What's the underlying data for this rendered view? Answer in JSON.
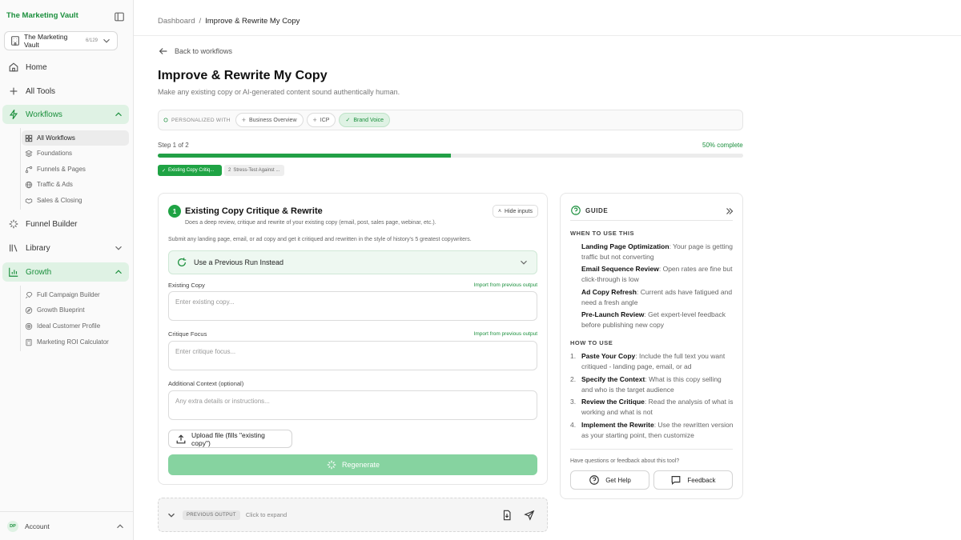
{
  "sidebar": {
    "brand": "The Marketing Vault",
    "workspace": {
      "name": "The Marketing Vault",
      "count": "6/129"
    },
    "nav": {
      "home": "Home",
      "all_tools": "All Tools",
      "workflows": "Workflows",
      "funnel_builder": "Funnel Builder",
      "library": "Library",
      "growth": "Growth"
    },
    "workflow_items": [
      "All Workflows",
      "Foundations",
      "Funnels & Pages",
      "Traffic & Ads",
      "Sales & Closing"
    ],
    "growth_items": [
      "Full Campaign Builder",
      "Growth Blueprint",
      "Ideal Customer Profile",
      "Marketing ROI Calculator"
    ],
    "account": {
      "initials": "DP",
      "label": "Account"
    }
  },
  "breadcrumb": {
    "root": "Dashboard",
    "sep": "/",
    "current": "Improve & Rewrite My Copy"
  },
  "back_label": "Back to workflows",
  "page": {
    "title": "Improve & Rewrite My Copy",
    "subtitle": "Make any existing copy or AI-generated content sound authentically human."
  },
  "personalized": {
    "label": "PERSONALIZED WITH",
    "chips": [
      "Business Overview",
      "ICP",
      "Brand Voice"
    ]
  },
  "progress": {
    "step_text": "Step 1 of 2",
    "percent_text": "50% complete",
    "fraction": 0.5
  },
  "step_tabs": [
    "Existing Copy Critiq...",
    "Stress-Test Against ..."
  ],
  "step_tab_number": "2",
  "step_card": {
    "number": "1",
    "title": "Existing Copy Critique & Rewrite",
    "description": "Does a deep review, critique and rewrite of your existing copy (email, post, sales page, webinar, etc.).",
    "hide_inputs": "Hide inputs",
    "note": "Submit any landing page, email, or ad copy and get it critiqued and rewritten in the style of history's 5 greatest copywriters.",
    "previous_run": "Use a Previous Run Instead",
    "fields": {
      "existing_copy": {
        "label": "Existing Copy",
        "placeholder": "Enter existing copy...",
        "import": "Import from previous output"
      },
      "critique_focus": {
        "label": "Critique Focus",
        "placeholder": "Enter critique focus...",
        "import": "Import from previous output"
      },
      "additional_context": {
        "label": "Additional Context (optional)",
        "placeholder": "Any extra details or instructions..."
      }
    },
    "upload": "Upload file (fills \"existing copy\")",
    "regenerate": "Regenerate"
  },
  "previous_output": {
    "badge": "PREVIOUS OUTPUT",
    "expand": "Click to expand"
  },
  "guide": {
    "title": "GUIDE",
    "when_heading": "WHEN TO USE THIS",
    "when": [
      {
        "b": "Landing Page Optimization",
        "t": ": Your page is getting traffic but not converting"
      },
      {
        "b": "Email Sequence Review",
        "t": ": Open rates are fine but click-through is low"
      },
      {
        "b": "Ad Copy Refresh",
        "t": ": Current ads have fatigued and need a fresh angle"
      },
      {
        "b": "Pre-Launch Review",
        "t": ": Get expert-level feedback before publishing new copy"
      }
    ],
    "how_heading": "HOW TO USE",
    "how": [
      {
        "n": "1.",
        "b": "Paste Your Copy",
        "t": ": Include the full text you want critiqued - landing page, email, or ad"
      },
      {
        "n": "2.",
        "b": "Specify the Context",
        "t": ": What is this copy selling and who is the target audience"
      },
      {
        "n": "3.",
        "b": "Review the Critique",
        "t": ": Read the analysis of what is working and what is not"
      },
      {
        "n": "4.",
        "b": "Implement the Rewrite",
        "t": ": Use the rewritten version as your starting point, then customize"
      }
    ],
    "question": "Have questions or feedback about this tool?",
    "help": "Get Help",
    "feedback": "Feedback"
  },
  "colors": {
    "accent": "#1fa344",
    "accent_light": "#dff2e4",
    "regen": "#86d3a0"
  }
}
